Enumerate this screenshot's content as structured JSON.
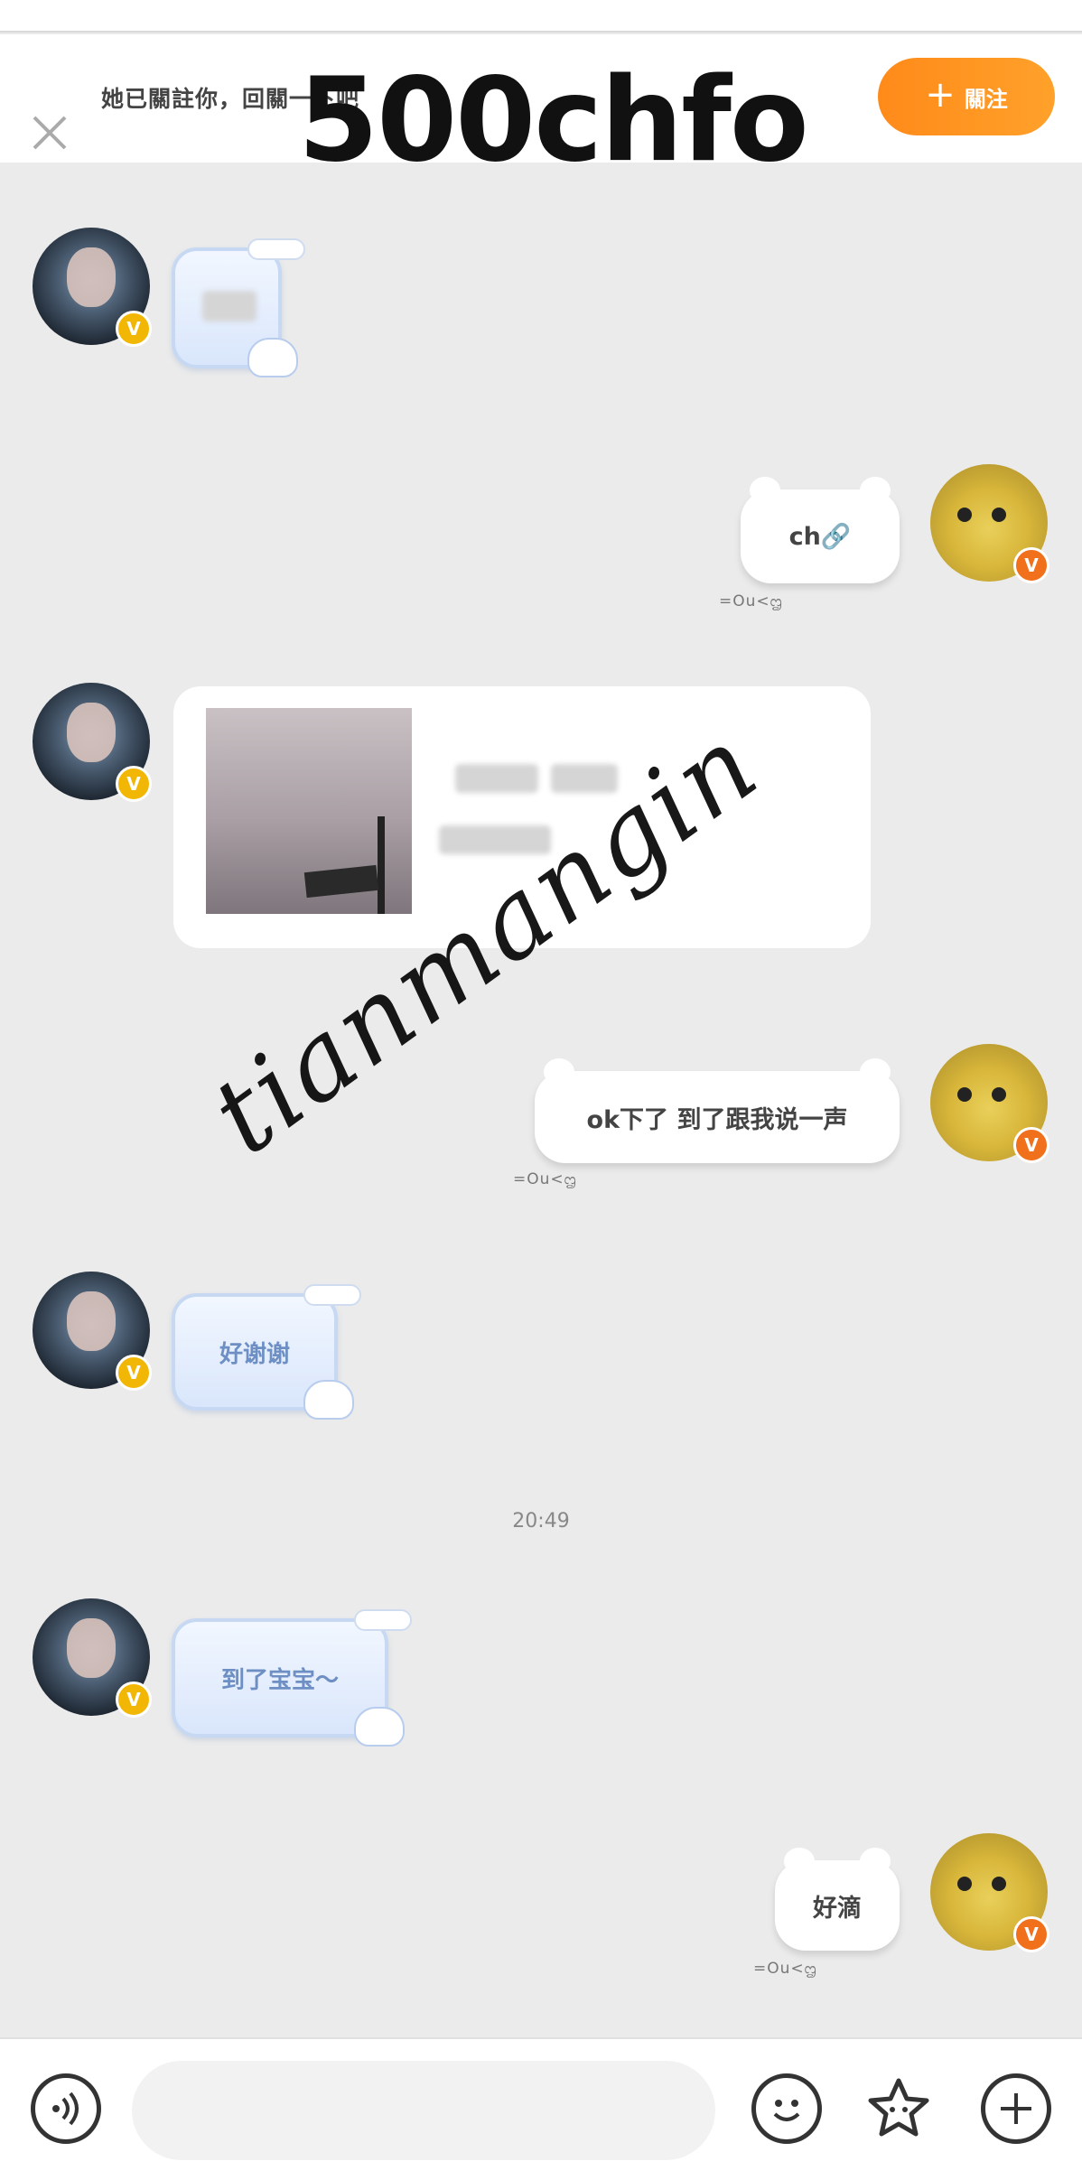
{
  "header": {
    "banner_text": "她已關註你，回關一下吧",
    "follow_button": "關注",
    "overlay_title": "500chfo"
  },
  "messages": [
    {
      "side": "left",
      "type": "blurred"
    },
    {
      "side": "right",
      "text": "ch🔗",
      "sticker": "=Ou<ᦗ"
    },
    {
      "side": "left",
      "type": "link-card"
    },
    {
      "side": "right",
      "text": "ok下了 到了跟我说一声",
      "sticker": "=Ou<ᦗ"
    },
    {
      "side": "left",
      "text": "好谢谢"
    },
    {
      "side": "left",
      "text": "到了宝宝～"
    },
    {
      "side": "right",
      "text": "好滴",
      "sticker": "=Ou<ᦗ"
    }
  ],
  "timestamp": "20:49",
  "watermark": "tianmangin",
  "bottom_bar": {
    "input_placeholder": "",
    "icons": [
      "voice-icon",
      "emoji-icon",
      "sticker-star-icon",
      "plus-icon"
    ]
  },
  "colors": {
    "accent": "#ff9a1f",
    "her_badge": "#f2b705",
    "my_badge": "#f0701c",
    "cloud_bubble_text": "#6e8fc4"
  }
}
